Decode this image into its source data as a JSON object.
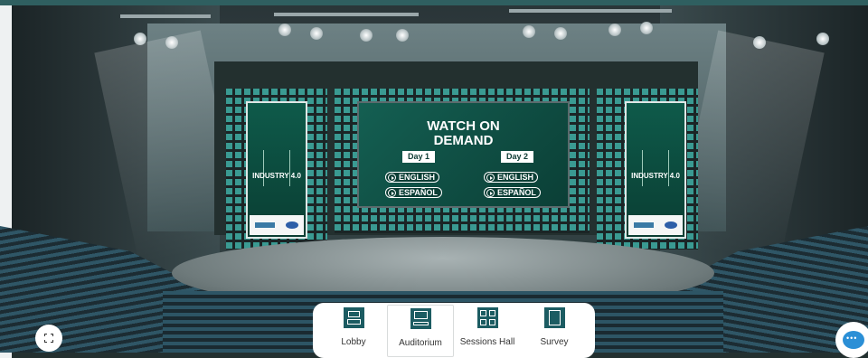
{
  "screen": {
    "title": "WATCH ON DEMAND",
    "day1": "Day 1",
    "day2": "Day 2",
    "english": "ENGLISH",
    "spanish": "ESPAÑOL"
  },
  "banners": {
    "title": "INDUSTRY 4.0"
  },
  "nav": {
    "items": [
      {
        "label": "Lobby",
        "icon": "lobby-icon"
      },
      {
        "label": "Auditorium",
        "icon": "auditorium-icon",
        "active": true
      },
      {
        "label": "Sessions Hall",
        "icon": "sessions-hall-icon"
      },
      {
        "label": "Survey",
        "icon": "survey-icon"
      }
    ]
  },
  "colors": {
    "accent": "#1c5c62",
    "screen_bg": "#0b3f36",
    "chat": "#2b8fd6"
  }
}
